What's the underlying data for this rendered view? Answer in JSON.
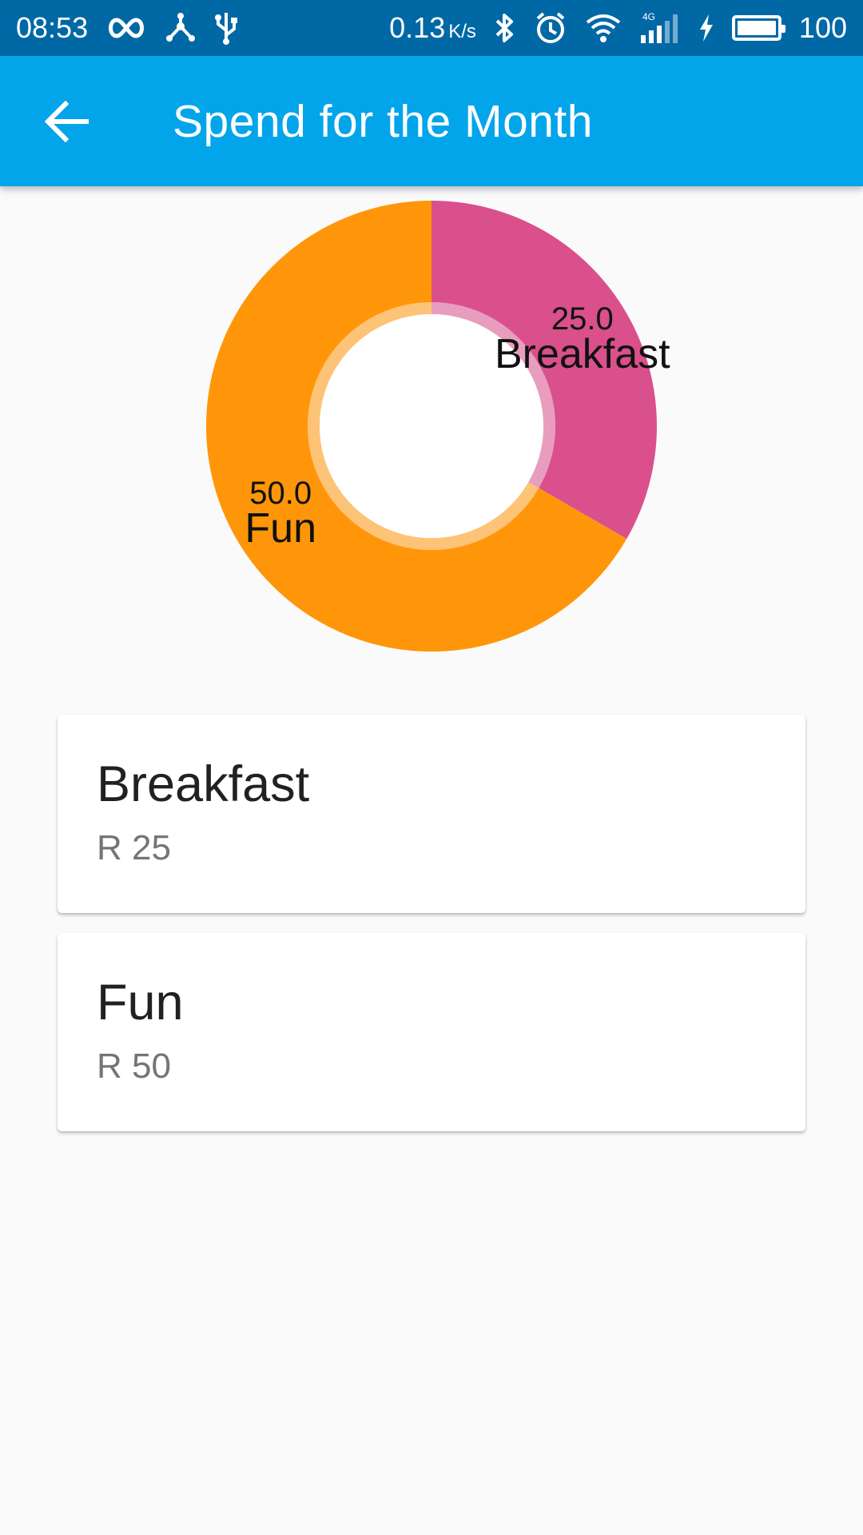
{
  "status_bar": {
    "time": "08:53",
    "left_icons": [
      "infinity-icon",
      "share-hub-icon",
      "usb-icon"
    ],
    "net_speed": "0.13",
    "net_speed_unit": "K/s",
    "right_icons": [
      "bluetooth-icon",
      "alarm-icon",
      "wifi-icon",
      "signal-4g-icon",
      "charging-icon"
    ],
    "signal_label": "4G",
    "battery_level": 100,
    "battery_text": "100"
  },
  "app_bar": {
    "back_icon": "arrow-back-icon",
    "title": "Spend for the Month",
    "color": "#03a5ea"
  },
  "chart_data": {
    "type": "pie",
    "variant": "donut",
    "categories": [
      "Breakfast",
      "Fun"
    ],
    "values": [
      25.0,
      50.0
    ],
    "value_labels": [
      "25.0",
      "50.0"
    ],
    "colors": [
      "#d9508c",
      "#ff9609"
    ],
    "title": "",
    "legend": "none"
  },
  "expenses": [
    {
      "name": "Breakfast",
      "amount": "R 25"
    },
    {
      "name": "Fun",
      "amount": "R 50"
    }
  ]
}
